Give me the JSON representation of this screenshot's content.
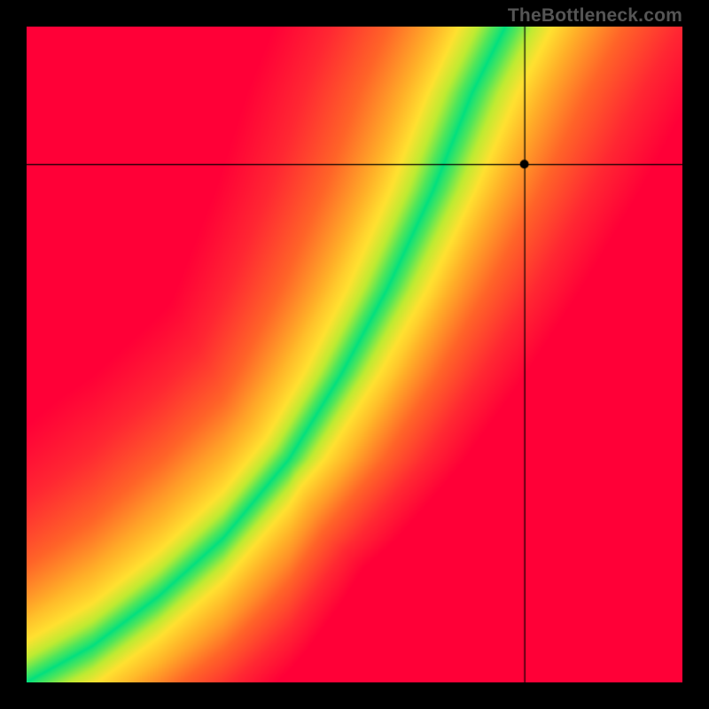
{
  "watermark": "TheBottleneck.com",
  "chart_data": {
    "type": "heatmap",
    "title": "",
    "xlabel": "",
    "ylabel": "",
    "xlim": [
      0,
      1
    ],
    "ylim": [
      0,
      1
    ],
    "grid": false,
    "legend": false,
    "marker": {
      "x": 0.76,
      "y": 0.79
    },
    "crosshair": {
      "x": 0.76,
      "y": 0.79
    },
    "optimal_curve_description": "Green optimal band runs from bottom-left corner diagonally up, curving slightly, to upper-middle-right region. Colors transition from red (far from band) through orange/yellow to green (on band).",
    "sample_colors_at_points": [
      {
        "x": 0.0,
        "y": 1.0,
        "color": "#ff0030"
      },
      {
        "x": 0.0,
        "y": 0.0,
        "color": "#ff3020"
      },
      {
        "x": 0.5,
        "y": 0.5,
        "color": "#00e080"
      },
      {
        "x": 0.76,
        "y": 0.79,
        "color": "#d0e040"
      },
      {
        "x": 1.0,
        "y": 0.0,
        "color": "#ff0030"
      },
      {
        "x": 1.0,
        "y": 1.0,
        "color": "#ffe030"
      },
      {
        "x": 0.3,
        "y": 0.8,
        "color": "#ff3020"
      },
      {
        "x": 0.65,
        "y": 0.85,
        "color": "#00e080"
      }
    ],
    "color_scale": {
      "worst": "#ff0030",
      "bad": "#ff6020",
      "mid": "#ffd030",
      "near": "#d0ff30",
      "best": "#00e080"
    }
  }
}
